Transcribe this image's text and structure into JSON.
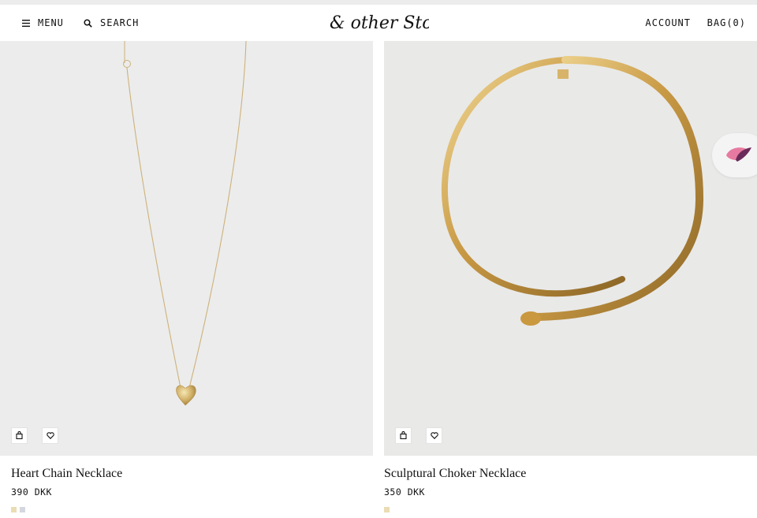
{
  "header": {
    "menu_label": "MENU",
    "search_label": "SEARCH",
    "logo_text": "& other Stories",
    "account_label": "ACCOUNT",
    "bag_label": "BAG(0)"
  },
  "products": [
    {
      "name": "Heart Chain Necklace",
      "price": "390 DKK",
      "swatches": [
        "#eadcb4",
        "#d4d8de"
      ]
    },
    {
      "name": "Sculptural Choker Necklace",
      "price": "350 DKK",
      "swatches": [
        "#eadcb4"
      ]
    }
  ],
  "icons": {
    "menu": "hamburger-icon",
    "search": "search-icon",
    "quick_add": "shopping-bag-icon",
    "wishlist": "heart-icon",
    "chat": "chat-widget-icon"
  }
}
